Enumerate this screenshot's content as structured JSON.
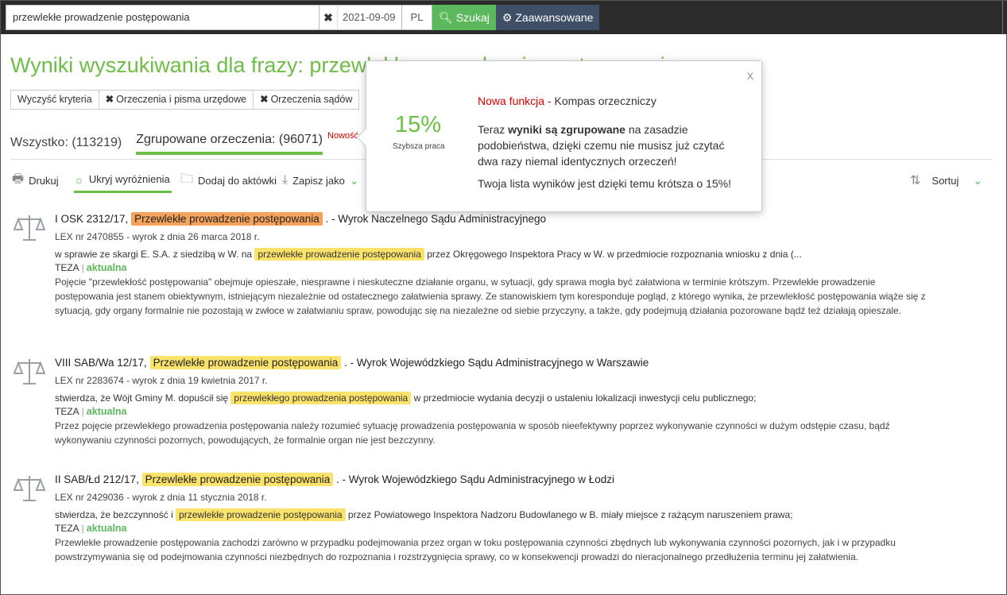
{
  "search": {
    "query": "przewlekłe prowadzenie postępowania",
    "date": "2021-09-09",
    "lang": "PL",
    "search_label": "Szukaj",
    "advanced_label": "Zaawansowane"
  },
  "page_title": "Wyniki wyszukiwania dla frazy: przewlekłe prowadzenie postępowania",
  "criteria": {
    "clear": "Wyczyść kryteria",
    "items": [
      "Orzeczenia i pisma urzędowe",
      "Orzeczenia sądów"
    ]
  },
  "tabs": {
    "all": "Wszystko: (113219)",
    "grouped": "Zgrupowane orzeczenia: (96071)",
    "new_badge": "Nowość"
  },
  "toolbar": {
    "print": "Drukuj",
    "hide_highlights": "Ukryj wyróżnienia",
    "add_to_files": "Dodaj do aktówki",
    "save_as": "Zapisz jako",
    "sort": "Sortuj"
  },
  "results": [
    {
      "sig": "I OSK 2312/17,",
      "hl": "Przewlekłe prowadzenie postępowania",
      "court": ". - Wyrok Naczelnego Sądu Administracyjnego",
      "meta": "LEX nr 2470855 - wyrok z dnia 26 marca 2018 r.",
      "snip_pre": "w sprawie ze skargi E. S.A. z siedzibą w W. na",
      "snip_hl": "przewlekłe prowadzenie postępowania",
      "snip_post": "przez Okręgowego Inspektora Pracy w W. w przedmiocie rozpoznania wniosku z dnia (...",
      "teza": "TEZA",
      "status": "aktualna",
      "text": "Pojęcie \"przewlekłość postępowania\" obejmuje opieszałe, niesprawne i nieskuteczne działanie organu, w sytuacji, gdy sprawa mogła być załatwiona w terminie krótszym. Przewlekłe prowadzenie postępowania jest stanem obiektywnym, istniejącym niezależnie od ostatecznego załatwienia sprawy. Ze stanowiskiem tym koresponduje pogląd, z którego wynika, że przewlekłość postępowania wiąże się z sytuacją, gdy organy formalnie nie pozostają w zwłoce w załatwianiu spraw, powodując się na niezależne od siebie przyczyny, a także, gdy podejmują działania pozorowane bądź też działają opieszale."
    },
    {
      "sig": "VIII SAB/Wa 12/17,",
      "hl": "Przewlekłe prowadzenie postępowania",
      "court": ". - Wyrok Wojewódzkiego Sądu Administracyjnego w Warszawie",
      "meta": "LEX nr 2283674 - wyrok z dnia 19 kwietnia 2017 r.",
      "snip_pre": "stwierdza, że Wójt Gminy M. dopuścił się",
      "snip_hl": "przewlekłego prowadzenia postępowania",
      "snip_post": "w przedmiocie wydania decyzji o ustaleniu lokalizacji inwestycji celu publicznego;",
      "teza": "TEZA",
      "status": "aktualna",
      "text": "Przez pojęcie przewlekłego prowadzenia postępowania należy rozumieć sytuację prowadzenia postępowania w sposób nieefektywny poprzez wykonywanie czynności w dużym odstępie czasu, bądź wykonywaniu czynności pozornych, powodujących, że formalnie organ nie jest bezczynny."
    },
    {
      "sig": "II SAB/Łd 212/17,",
      "hl": "Przewlekłe prowadzenie postępowania",
      "court": ". - Wyrok Wojewódzkiego Sądu Administracyjnego w Łodzi",
      "meta": "LEX nr 2429036 - wyrok z dnia 11 stycznia 2018 r.",
      "snip_pre": "stwierdza, że bezczynność i",
      "snip_hl": "przewlekłe prowadzenie postępowania",
      "snip_post": "przez Powiatowego Inspektora Nadzoru Budowlanego w B. miały miejsce z rażącym naruszeniem prawa;",
      "teza": "TEZA",
      "status": "aktualna",
      "text": "Przewlekłe prowadzenie postępowania zachodzi zarówno w przypadku podejmowania przez organ w toku postępowania czynności zbędnych lub wykonywania czynności pozornych, jak i w przypadku powstrzymywania się od podejmowania czynności niezbędnych do rozpoznania i rozstrzygnięcia sprawy, co w konsekwencji prowadzi do nieracjonalnego przedłużenia terminu jej załatwienia."
    }
  ],
  "popover": {
    "close": "x",
    "pct": "15%",
    "pct_label": "Szybsza praca",
    "head_red": "Nowa funkcja -",
    "head_rest": "Kompas orzeczniczy",
    "para_pre": "Teraz",
    "para_bold": "wyniki są zgrupowane",
    "para_post": "na zasadzie podobieństwa, dzięki czemu nie musisz już czytać dwa razy niemal identycznych orzeczeń!",
    "para2": "Twoja lista wyników jest dzięki temu krótsza o 15%!"
  },
  "colors": {
    "accent": "#6dbe45",
    "highlight": "#fbe26a",
    "highlight_active": "#f5a35c",
    "badge": "#cc0000"
  }
}
